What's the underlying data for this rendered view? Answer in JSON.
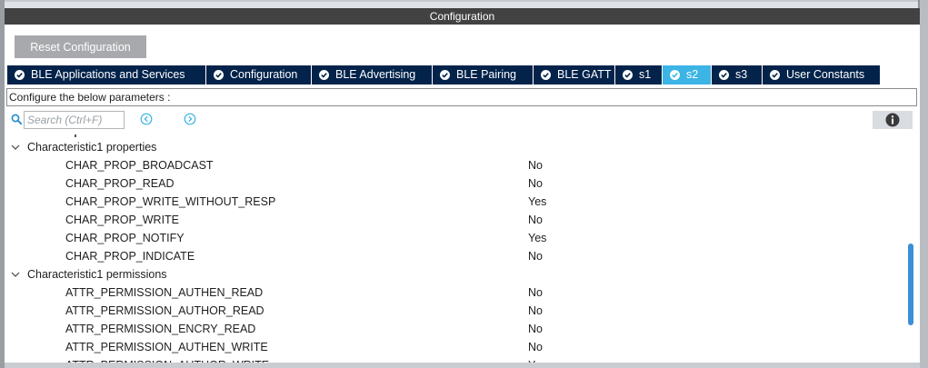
{
  "panel": {
    "title": "Configuration"
  },
  "toolbar": {
    "reset_label": "Reset Configuration"
  },
  "tabs": [
    {
      "label": "BLE Applications and Services",
      "icon": "check-circle-icon",
      "active": false
    },
    {
      "label": "Configuration",
      "icon": "check-circle-icon",
      "active": false
    },
    {
      "label": "BLE Advertising",
      "icon": "check-circle-icon",
      "active": false
    },
    {
      "label": "BLE Pairing",
      "icon": "check-circle-icon",
      "active": false
    },
    {
      "label": "BLE GATT",
      "icon": "check-circle-icon",
      "active": false
    },
    {
      "label": "s1",
      "icon": "check-circle-icon",
      "active": false
    },
    {
      "label": "s2",
      "icon": "check-circle-icon",
      "active": true
    },
    {
      "label": "s3",
      "icon": "check-circle-icon",
      "active": false
    },
    {
      "label": "User Constants",
      "icon": "check-circle-icon",
      "active": false
    }
  ],
  "description": "Configure the below parameters :",
  "search": {
    "placeholder": "Search (Ctrl+F)",
    "value": ""
  },
  "groups": [
    {
      "name": "Characteristic1 properties",
      "expanded": true,
      "params": [
        {
          "name": "CHAR_PROP_BROADCAST",
          "value": "No"
        },
        {
          "name": "CHAR_PROP_READ",
          "value": "No"
        },
        {
          "name": "CHAR_PROP_WRITE_WITHOUT_RESP",
          "value": "Yes"
        },
        {
          "name": "CHAR_PROP_WRITE",
          "value": "No"
        },
        {
          "name": "CHAR_PROP_NOTIFY",
          "value": "Yes"
        },
        {
          "name": "CHAR_PROP_INDICATE",
          "value": "No"
        }
      ]
    },
    {
      "name": "Characteristic1 permissions",
      "expanded": true,
      "params": [
        {
          "name": "ATTR_PERMISSION_AUTHEN_READ",
          "value": "No"
        },
        {
          "name": "ATTR_PERMISSION_AUTHOR_READ",
          "value": "No"
        },
        {
          "name": "ATTR_PERMISSION_ENCRY_READ",
          "value": "No"
        },
        {
          "name": "ATTR_PERMISSION_AUTHEN_WRITE",
          "value": "No"
        },
        {
          "name": "ATTR_PERMISSION_AUTHOR_WRITE",
          "value": "Yes"
        }
      ]
    }
  ],
  "colors": {
    "tab_bg": "#03234b",
    "tab_active_bg": "#3cb4e6",
    "header_bg": "#424242",
    "button_bg": "#a7a9ac",
    "scrollbar": "#3b8fd8",
    "nav_icon": "#3cb4e6"
  }
}
